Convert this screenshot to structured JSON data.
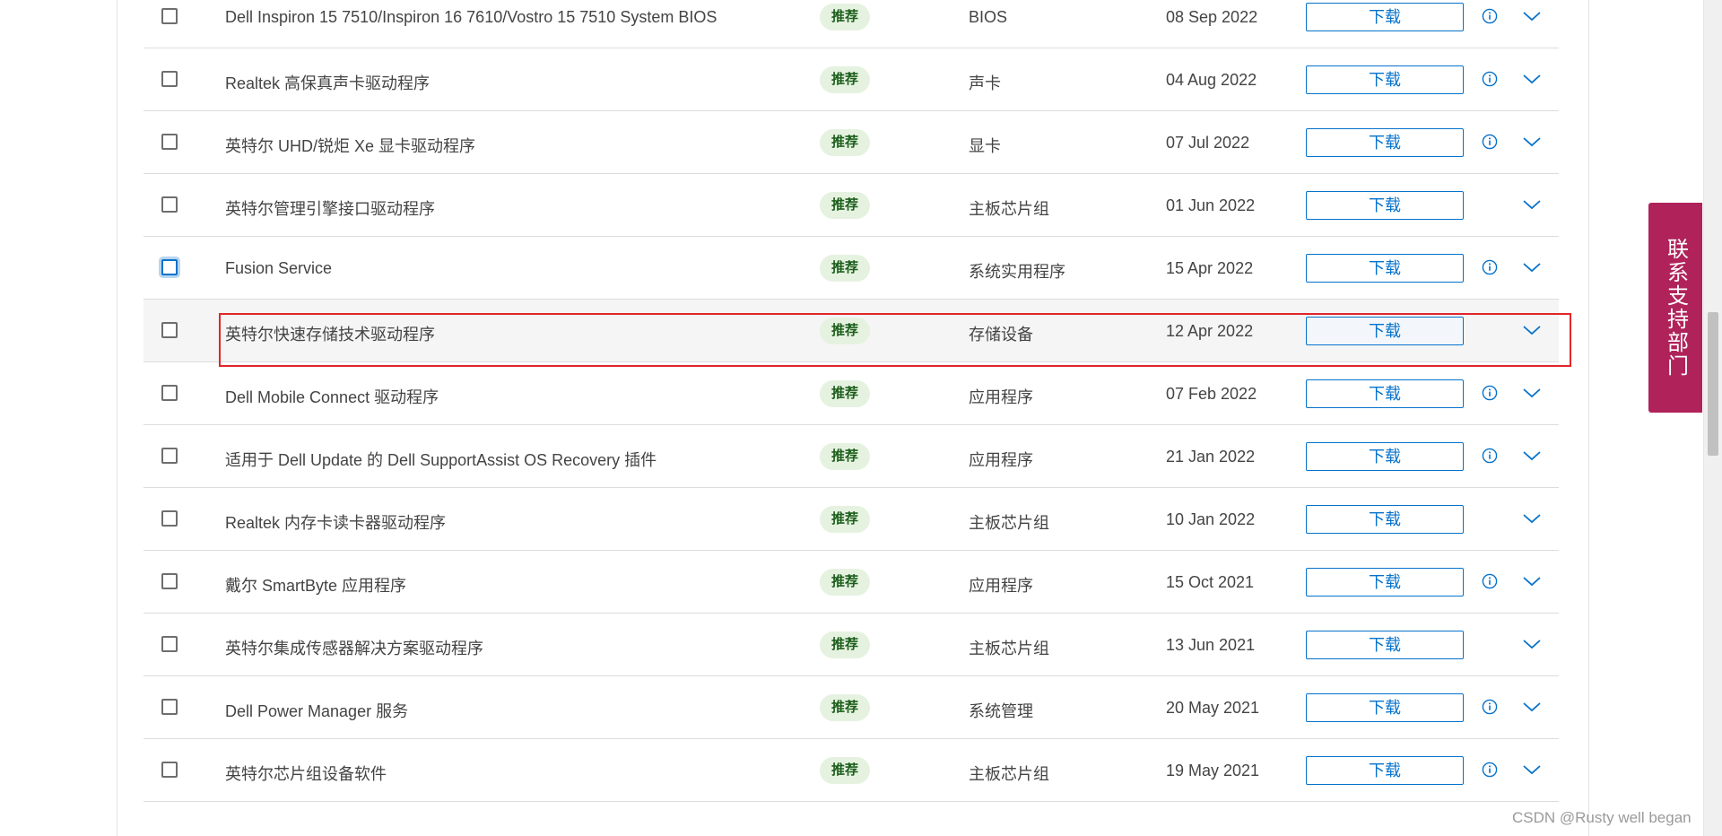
{
  "drivers": {
    "rows": [
      {
        "name": "Dell Inspiron 15 7510/Inspiron 16 7610/Vostro 15 7510 System BIOS",
        "badge": "推荐",
        "category": "BIOS",
        "date": "08 Sep 2022",
        "download": "下载",
        "info": true
      },
      {
        "name": "Realtek 高保真声卡驱动程序",
        "badge": "推荐",
        "category": "声卡",
        "date": "04 Aug 2022",
        "download": "下载",
        "info": true
      },
      {
        "name": "英特尔 UHD/锐炬 Xe 显卡驱动程序",
        "badge": "推荐",
        "category": "显卡",
        "date": "07 Jul 2022",
        "download": "下载",
        "info": true
      },
      {
        "name": "英特尔管理引擎接口驱动程序",
        "badge": "推荐",
        "category": "主板芯片组",
        "date": "01 Jun 2022",
        "download": "下载",
        "info": false
      },
      {
        "name": "Fusion Service",
        "badge": "推荐",
        "category": "系统实用程序",
        "date": "15 Apr 2022",
        "download": "下载",
        "info": true
      },
      {
        "name": "英特尔快速存储技术驱动程序",
        "badge": "推荐",
        "category": "存储设备",
        "date": "12 Apr 2022",
        "download": "下载",
        "info": false
      },
      {
        "name": "Dell Mobile Connect 驱动程序",
        "badge": "推荐",
        "category": "应用程序",
        "date": "07 Feb 2022",
        "download": "下载",
        "info": true
      },
      {
        "name": "适用于 Dell Update 的 Dell SupportAssist OS Recovery 插件",
        "badge": "推荐",
        "category": "应用程序",
        "date": "21 Jan 2022",
        "download": "下载",
        "info": true
      },
      {
        "name": "Realtek 内存卡读卡器驱动程序",
        "badge": "推荐",
        "category": "主板芯片组",
        "date": "10 Jan 2022",
        "download": "下载",
        "info": false
      },
      {
        "name": "戴尔 SmartByte 应用程序",
        "badge": "推荐",
        "category": "应用程序",
        "date": "15 Oct 2021",
        "download": "下载",
        "info": true
      },
      {
        "name": "英特尔集成传感器解决方案驱动程序",
        "badge": "推荐",
        "category": "主板芯片组",
        "date": "13 Jun 2021",
        "download": "下载",
        "info": false
      },
      {
        "name": "Dell Power Manager 服务",
        "badge": "推荐",
        "category": "系统管理",
        "date": "20 May 2021",
        "download": "下载",
        "info": true
      },
      {
        "name": "英特尔芯片组设备软件",
        "badge": "推荐",
        "category": "主板芯片组",
        "date": "19 May 2021",
        "download": "下载",
        "info": true
      }
    ],
    "focused_checkbox_row": 4,
    "hovered_row": 5
  },
  "contact_tab": {
    "label": "联系支持部门"
  },
  "watermark": {
    "text": "CSDN @Rusty well began"
  },
  "colors": {
    "accent_blue": "#0672cb",
    "badge_bg": "#e6f2e0",
    "badge_text": "#1d5f1d",
    "contact_tab_bg": "#b0235a",
    "highlight_border": "#e0262b"
  },
  "icons": {
    "info": "info-circle-icon",
    "expand": "chevron-down-icon"
  }
}
